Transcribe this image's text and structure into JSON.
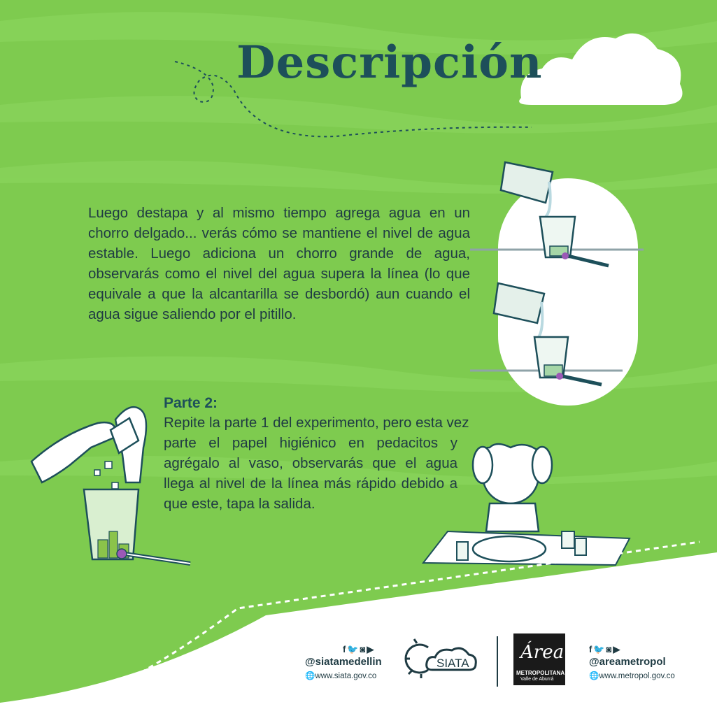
{
  "title": "Descripción",
  "paragraph1": "Luego destapa y al mismo tiempo agrega agua en un chorro delgado... verás cómo se mantiene el nivel de agua estable. Luego adiciona un chorro grande de agua, observarás como el nivel del agua supera la línea (lo que equivale a que la alcantarilla se desbordó) aun cuando el agua sigue saliendo por el pitillo.",
  "part2": {
    "heading": "Parte 2:",
    "line1": "Repite la parte 1 del experimento, pero esta vez",
    "body": "parte el papel higiénico en pedacitos y agrégalo al vaso, observarás que el agua llega al nivel de la línea más rápido debido a que este, tapa la salida."
  },
  "footer": {
    "siata": {
      "handle": "@siatamedellin",
      "website": "www.siata.gov.co",
      "logo_text": "SIATA",
      "social_icons": [
        "facebook-icon",
        "twitter-icon",
        "instagram-icon",
        "youtube-icon"
      ]
    },
    "area": {
      "handle": "@areametropol",
      "website": "www.metropol.gov.co",
      "logo_word": "Área",
      "logo_sub1": "METROPOLITANA",
      "logo_sub2": "Valle de Aburrá",
      "social_icons": [
        "facebook-icon",
        "twitter-icon",
        "instagram-icon",
        "youtube-icon"
      ]
    }
  },
  "colors": {
    "background": "#7ecb4f",
    "title": "#1d4f5a",
    "text": "#1f3b43",
    "white": "#ffffff"
  }
}
